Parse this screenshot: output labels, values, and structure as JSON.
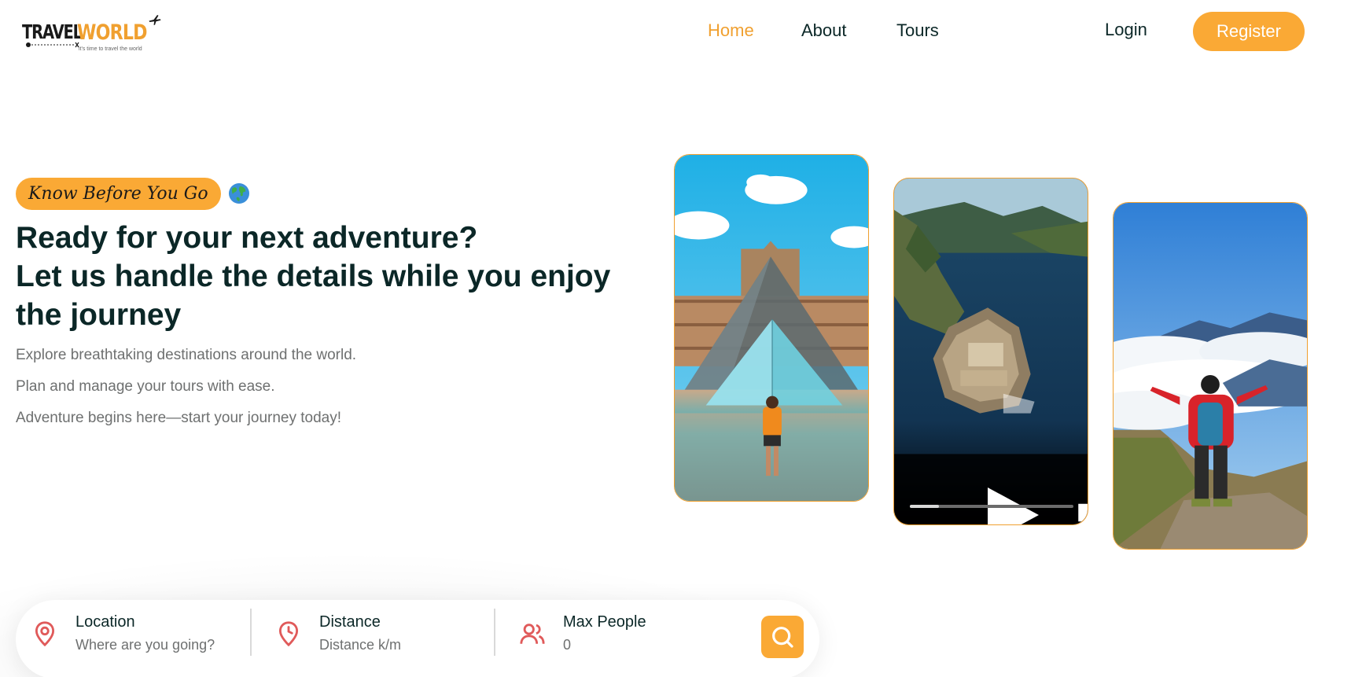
{
  "brand": {
    "logo_primary": "TRAVEL",
    "logo_secondary": "WORLD",
    "tagline": "it's time to travel the world",
    "accent_color": "#faa935",
    "dark_text_color": "#0b2727"
  },
  "nav": {
    "items": [
      {
        "label": "Home",
        "active": true
      },
      {
        "label": "About",
        "active": false
      },
      {
        "label": "Tours",
        "active": false
      }
    ],
    "login_label": "Login",
    "register_label": "Register"
  },
  "hero": {
    "subtitle": "Know Before You Go",
    "subtitle_icon": "globe-icon",
    "title_lines": [
      "Ready for your next adventure?",
      "Let us handle the details while you enjoy",
      "the journey"
    ],
    "descriptions": [
      "Explore breathtaking destinations around the world.",
      "Plan and manage your tours with ease.",
      "Adventure begins here—start your journey today!"
    ],
    "media": [
      {
        "type": "image",
        "subject": "louvre-pyramid"
      },
      {
        "type": "video",
        "subject": "island-fortress",
        "progress": 0.18,
        "controls": [
          "play-icon",
          "volume-icon",
          "more-vertical-icon"
        ]
      },
      {
        "type": "image",
        "subject": "hiker-mountain-clouds"
      }
    ]
  },
  "search": {
    "fields": [
      {
        "label": "Location",
        "placeholder": "Where are you going?",
        "value": "",
        "icon": "map-pin-icon"
      },
      {
        "label": "Distance",
        "placeholder": "Distance k/m",
        "value": "",
        "icon": "clock-icon"
      },
      {
        "label": "Max People",
        "placeholder": "",
        "value": "0",
        "icon": "users-icon"
      }
    ],
    "button_icon": "search-icon"
  }
}
